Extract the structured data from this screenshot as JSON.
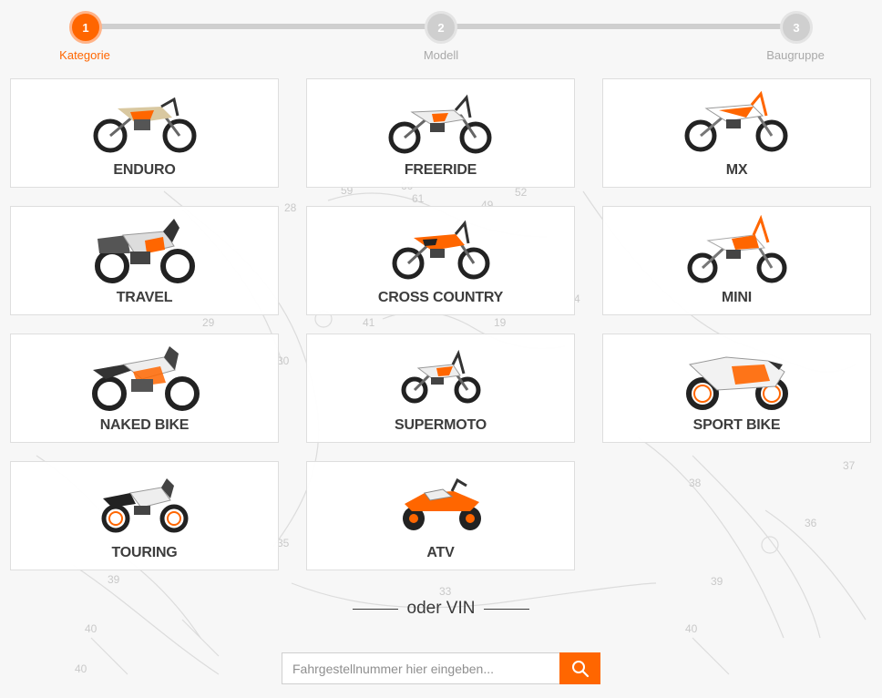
{
  "colors": {
    "accent": "#ff6600",
    "inactive_step": "#cfcfcf"
  },
  "stepper": {
    "steps": [
      {
        "number": "1",
        "label": "Kategorie",
        "active": true
      },
      {
        "number": "2",
        "label": "Modell",
        "active": false
      },
      {
        "number": "3",
        "label": "Baugruppe",
        "active": false
      }
    ]
  },
  "categories": [
    {
      "label": "ENDURO",
      "icon": "enduro-bike-icon"
    },
    {
      "label": "FREERIDE",
      "icon": "freeride-bike-icon"
    },
    {
      "label": "MX",
      "icon": "mx-bike-icon"
    },
    {
      "label": "TRAVEL",
      "icon": "travel-bike-icon"
    },
    {
      "label": "CROSS COUNTRY",
      "icon": "cross-country-bike-icon"
    },
    {
      "label": "MINI",
      "icon": "mini-bike-icon"
    },
    {
      "label": "NAKED BIKE",
      "icon": "naked-bike-icon"
    },
    {
      "label": "SUPERMOTO",
      "icon": "supermoto-bike-icon"
    },
    {
      "label": "SPORT BIKE",
      "icon": "sport-bike-icon"
    },
    {
      "label": "TOURING",
      "icon": "touring-bike-icon"
    },
    {
      "label": "ATV",
      "icon": "atv-icon"
    }
  ],
  "vin": {
    "heading": "oder VIN",
    "placeholder": "Fahrgestellnummer hier eingeben...",
    "value": "",
    "button_icon": "search-icon"
  },
  "background": {
    "callout_numbers": [
      "59",
      "60",
      "61",
      "52",
      "49",
      "28",
      "29",
      "41",
      "19",
      "4",
      "30",
      "38",
      "37",
      "36",
      "35",
      "33",
      "39",
      "40",
      "40",
      "39",
      "40"
    ]
  }
}
